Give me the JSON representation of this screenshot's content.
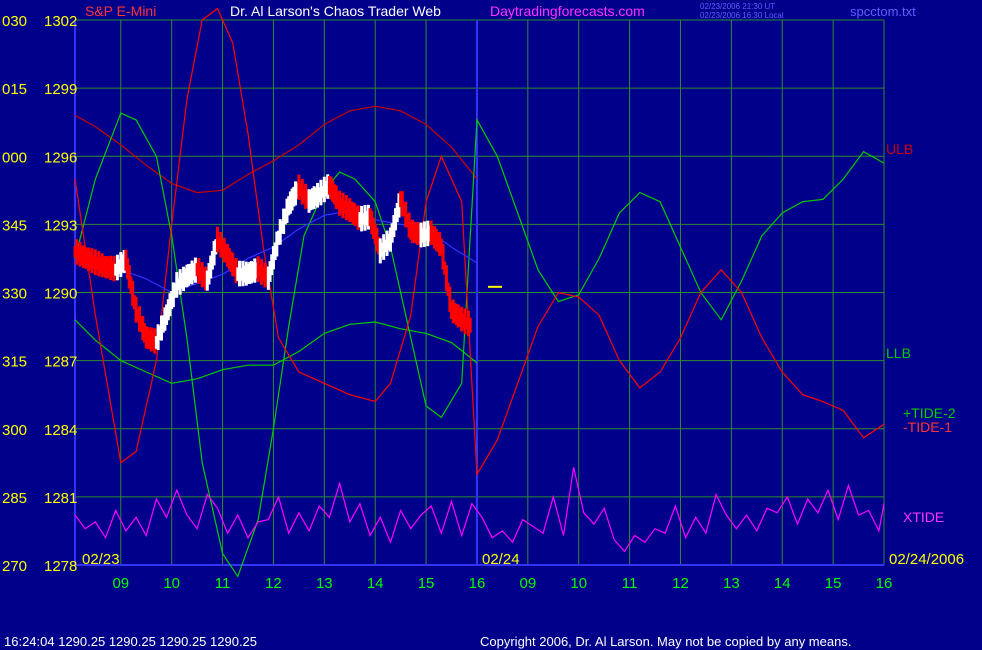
{
  "header": {
    "instrument": "S&P E-Mini",
    "title": "Dr. Al Larson's Chaos Trader Web",
    "site": "Daytradingforecasts.com",
    "stamp_ut": "02/23/2006 21:30 UT",
    "stamp_local": "02/23/2006 16:30 Local",
    "filename": "spcctom.txt"
  },
  "footer": {
    "quote": "16:24:04  1290.25 1290.25 1290.25 1290.25",
    "copyright": "Copyright 2006, Dr. Al Larson. May not be copied by any means."
  },
  "colors": {
    "background": "#00008b",
    "grid": "#2e8b2e",
    "axis_time": "#00ff00",
    "axis_price": "#ffff00",
    "ulb": "#cc0000",
    "llb": "#00cc00",
    "tide_plus": "#00cc00",
    "tide_minus": "#ff0000",
    "xtide": "#ff00ff",
    "ma": "#3333ff",
    "price_up": "#ffffff",
    "price_down": "#ff0000",
    "now_marker": "#ffff00"
  },
  "chart_data": {
    "type": "line",
    "title": "Dr. Al Larson's Chaos Trader Web",
    "x_ticks": [
      "09",
      "10",
      "11",
      "12",
      "13",
      "14",
      "15",
      "16",
      "09",
      "10",
      "11",
      "12",
      "13",
      "14",
      "15",
      "16"
    ],
    "date_labels": [
      "02/23",
      "02/24",
      "02/24/2006"
    ],
    "y_ticks_degree": [
      "030",
      "015",
      "000",
      "345",
      "330",
      "315",
      "300",
      "285",
      "270"
    ],
    "y_ticks_price": [
      "1302",
      "1299",
      "1296",
      "1293",
      "1290",
      "1287",
      "1284",
      "1281",
      "1278"
    ],
    "ylim": [
      1278,
      1302
    ],
    "xlim": [
      8.1,
      24.0
    ],
    "current_price": 1290.25,
    "series": [
      {
        "name": "ULB",
        "x": [
          8.1,
          8.5,
          9.0,
          9.5,
          10.0,
          10.5,
          11.0,
          11.5,
          12.0,
          12.5,
          13.0,
          13.5,
          14.0,
          14.5,
          15.0,
          15.5,
          16.0
        ],
        "y": [
          1297.8,
          1297.3,
          1296.5,
          1295.6,
          1294.8,
          1294.4,
          1294.5,
          1295.2,
          1295.8,
          1296.5,
          1297.4,
          1298.0,
          1298.2,
          1298.0,
          1297.4,
          1296.4,
          1295.0
        ]
      },
      {
        "name": "LLB",
        "x": [
          8.1,
          8.5,
          9.0,
          9.5,
          10.0,
          10.5,
          11.0,
          11.5,
          12.0,
          12.5,
          13.0,
          13.5,
          14.0,
          14.5,
          15.0,
          15.5,
          16.0
        ],
        "y": [
          1288.8,
          1287.9,
          1287.0,
          1286.5,
          1286.0,
          1286.2,
          1286.6,
          1286.8,
          1286.8,
          1287.4,
          1288.2,
          1288.6,
          1288.7,
          1288.4,
          1288.2,
          1287.8,
          1286.9
        ]
      },
      {
        "name": "+TIDE-2",
        "x": [
          8.1,
          8.5,
          9.0,
          9.3,
          9.7,
          10.0,
          10.3,
          10.6,
          11.0,
          11.3,
          11.7,
          12.0,
          12.3,
          12.6,
          13.0,
          13.3,
          13.6,
          14.0,
          14.3,
          14.7,
          15.0,
          15.3,
          15.7,
          16.0,
          16.4,
          16.8,
          17.2,
          17.6,
          18.0,
          18.4,
          18.8,
          19.2,
          19.6,
          20.0,
          20.4,
          20.8,
          21.2,
          21.6,
          22.0,
          22.4,
          22.8,
          23.2,
          23.6,
          24.0
        ],
        "y": [
          1291.5,
          1295.0,
          1297.9,
          1297.6,
          1296.0,
          1292.5,
          1288.0,
          1282.5,
          1278.5,
          1277.5,
          1280.0,
          1284.0,
          1288.5,
          1292.5,
          1294.5,
          1295.3,
          1295.0,
          1294.0,
          1292.0,
          1288.0,
          1285.0,
          1284.5,
          1286.0,
          1297.6,
          1296.0,
          1293.5,
          1291.0,
          1289.6,
          1289.9,
          1291.5,
          1293.5,
          1294.4,
          1294.0,
          1292.0,
          1290.0,
          1288.8,
          1290.5,
          1292.5,
          1293.5,
          1294.0,
          1294.1,
          1295.0,
          1296.2,
          1295.7
        ]
      },
      {
        "name": "-TIDE-1",
        "x": [
          8.1,
          8.5,
          9.0,
          9.3,
          9.7,
          10.0,
          10.3,
          10.6,
          10.9,
          11.2,
          11.5,
          11.8,
          12.1,
          12.5,
          13.0,
          13.5,
          14.0,
          14.3,
          14.7,
          15.0,
          15.3,
          15.7,
          16.0,
          16.4,
          16.8,
          17.2,
          17.6,
          18.0,
          18.4,
          18.8,
          19.2,
          19.6,
          20.0,
          20.4,
          20.8,
          21.2,
          21.6,
          22.0,
          22.4,
          22.8,
          23.2,
          23.6,
          24.0
        ],
        "y": [
          1295.0,
          1289.0,
          1282.5,
          1283.0,
          1287.0,
          1293.0,
          1298.5,
          1302.0,
          1302.5,
          1301.0,
          1297.0,
          1292.0,
          1288.0,
          1286.5,
          1286.0,
          1285.5,
          1285.2,
          1286.0,
          1289.0,
          1294.0,
          1296.0,
          1294.0,
          1282.0,
          1283.5,
          1286.0,
          1288.5,
          1290.0,
          1289.8,
          1289.0,
          1287.0,
          1285.8,
          1286.5,
          1288.0,
          1290.0,
          1291.0,
          1290.0,
          1288.0,
          1286.5,
          1285.5,
          1285.2,
          1284.8,
          1283.6,
          1284.2
        ]
      },
      {
        "name": "XTIDE",
        "x": [
          8.1,
          8.3,
          8.5,
          8.7,
          8.9,
          9.1,
          9.3,
          9.5,
          9.7,
          9.9,
          10.1,
          10.3,
          10.5,
          10.7,
          10.9,
          11.1,
          11.3,
          11.5,
          11.7,
          11.9,
          12.1,
          12.3,
          12.5,
          12.7,
          12.9,
          13.1,
          13.3,
          13.5,
          13.7,
          13.9,
          14.1,
          14.3,
          14.5,
          14.7,
          14.9,
          15.1,
          15.3,
          15.5,
          15.7,
          15.9,
          16.1,
          16.3,
          16.5,
          16.7,
          16.9,
          17.1,
          17.3,
          17.5,
          17.7,
          17.9,
          18.1,
          18.3,
          18.5,
          18.7,
          18.9,
          19.1,
          19.3,
          19.5,
          19.7,
          19.9,
          20.1,
          20.3,
          20.5,
          20.7,
          20.9,
          21.1,
          21.3,
          21.5,
          21.7,
          21.9,
          22.1,
          22.3,
          22.5,
          22.7,
          22.9,
          23.1,
          23.3,
          23.5,
          23.7,
          23.9,
          24.0
        ],
        "y": [
          1280.2,
          1279.6,
          1279.9,
          1279.2,
          1280.4,
          1279.5,
          1280.1,
          1279.3,
          1280.9,
          1280.1,
          1281.3,
          1280.2,
          1279.6,
          1281.1,
          1280.5,
          1279.4,
          1280.2,
          1279.2,
          1279.9,
          1280.0,
          1281.0,
          1279.4,
          1280.3,
          1279.5,
          1280.6,
          1280.1,
          1281.6,
          1279.9,
          1280.7,
          1279.3,
          1280.1,
          1279.0,
          1280.4,
          1279.6,
          1280.2,
          1280.6,
          1279.4,
          1280.8,
          1279.3,
          1280.7,
          1280.1,
          1279.2,
          1279.5,
          1279.0,
          1280.0,
          1279.7,
          1279.4,
          1281.0,
          1279.3,
          1282.3,
          1280.3,
          1279.8,
          1280.5,
          1279.1,
          1278.6,
          1279.3,
          1279.0,
          1279.6,
          1279.4,
          1280.6,
          1279.2,
          1280.1,
          1279.4,
          1281.1,
          1280.2,
          1279.6,
          1280.2,
          1279.5,
          1280.5,
          1280.3,
          1281.0,
          1279.8,
          1280.9,
          1280.3,
          1281.3,
          1280.0,
          1281.5,
          1280.2,
          1280.4,
          1279.5,
          1280.7
        ]
      },
      {
        "name": "MA",
        "x": [
          8.1,
          8.5,
          9.0,
          9.5,
          10.0,
          10.5,
          11.0,
          11.5,
          12.0,
          12.5,
          13.0,
          13.5,
          14.0,
          14.5,
          15.0,
          15.5,
          16.0
        ],
        "y": [
          1292.0,
          1291.6,
          1291.0,
          1290.6,
          1290.0,
          1290.4,
          1290.8,
          1291.5,
          1292.0,
          1292.8,
          1293.4,
          1293.6,
          1293.2,
          1293.0,
          1292.8,
          1292.0,
          1291.3
        ]
      },
      {
        "name": "Price",
        "x": [
          8.1,
          8.3,
          8.5,
          8.7,
          8.9,
          9.1,
          9.3,
          9.5,
          9.7,
          9.9,
          10.1,
          10.3,
          10.5,
          10.7,
          10.9,
          11.1,
          11.3,
          11.5,
          11.7,
          11.9,
          12.1,
          12.3,
          12.5,
          12.7,
          12.9,
          13.1,
          13.3,
          13.5,
          13.7,
          13.9,
          14.1,
          14.3,
          14.5,
          14.7,
          14.9,
          15.1,
          15.3,
          15.5,
          15.7,
          15.9
        ],
        "y": [
          1291.8,
          1291.5,
          1291.3,
          1291.1,
          1291.0,
          1291.4,
          1289.2,
          1288.0,
          1287.8,
          1289.0,
          1290.3,
          1290.7,
          1291.0,
          1290.5,
          1292.3,
          1291.6,
          1290.8,
          1290.8,
          1291.0,
          1290.6,
          1292.4,
          1293.8,
          1294.6,
          1294.0,
          1294.3,
          1294.7,
          1293.9,
          1293.6,
          1293.2,
          1293.3,
          1291.8,
          1292.3,
          1294.1,
          1292.7,
          1292.5,
          1292.6,
          1292.0,
          1289.2,
          1288.8,
          1288.5
        ]
      }
    ],
    "annotations": [
      {
        "text": "ULB"
      },
      {
        "text": "LLB"
      },
      {
        "text": "+TIDE-2"
      },
      {
        "text": "-TIDE-1"
      },
      {
        "text": "XTIDE"
      }
    ],
    "grid": true
  }
}
